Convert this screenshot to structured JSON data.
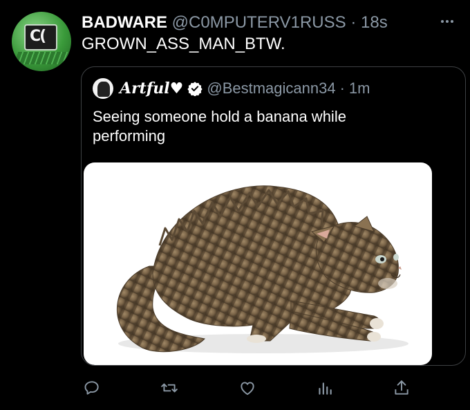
{
  "tweet": {
    "author_name": "BADWARE",
    "author_handle": "@C0MPUTERV1RUSS",
    "separator": "·",
    "time": "18s",
    "text": "GROWN_ASS_MAN_BTW.",
    "avatar_icon": "circuit-chip-icon"
  },
  "quoted_tweet": {
    "author_name": "Artful♥",
    "author_handle": "@Bestmagicann34",
    "separator": "·",
    "time": "1m",
    "text": "Seeing someone hold a banana while performing",
    "verified_icon": "verified-badge-icon",
    "media_description_icon": "frightened-kitten-image"
  },
  "actions": [
    {
      "name": "reply",
      "icon": "reply-icon"
    },
    {
      "name": "retweet",
      "icon": "retweet-icon"
    },
    {
      "name": "like",
      "icon": "heart-icon"
    },
    {
      "name": "views",
      "icon": "analytics-icon"
    },
    {
      "name": "share",
      "icon": "share-icon"
    }
  ],
  "colors": {
    "background": "#000000",
    "text_primary": "#ffffff",
    "text_secondary": "#8b98a5",
    "border": "#3e4144",
    "icon": "#8b98a5"
  }
}
